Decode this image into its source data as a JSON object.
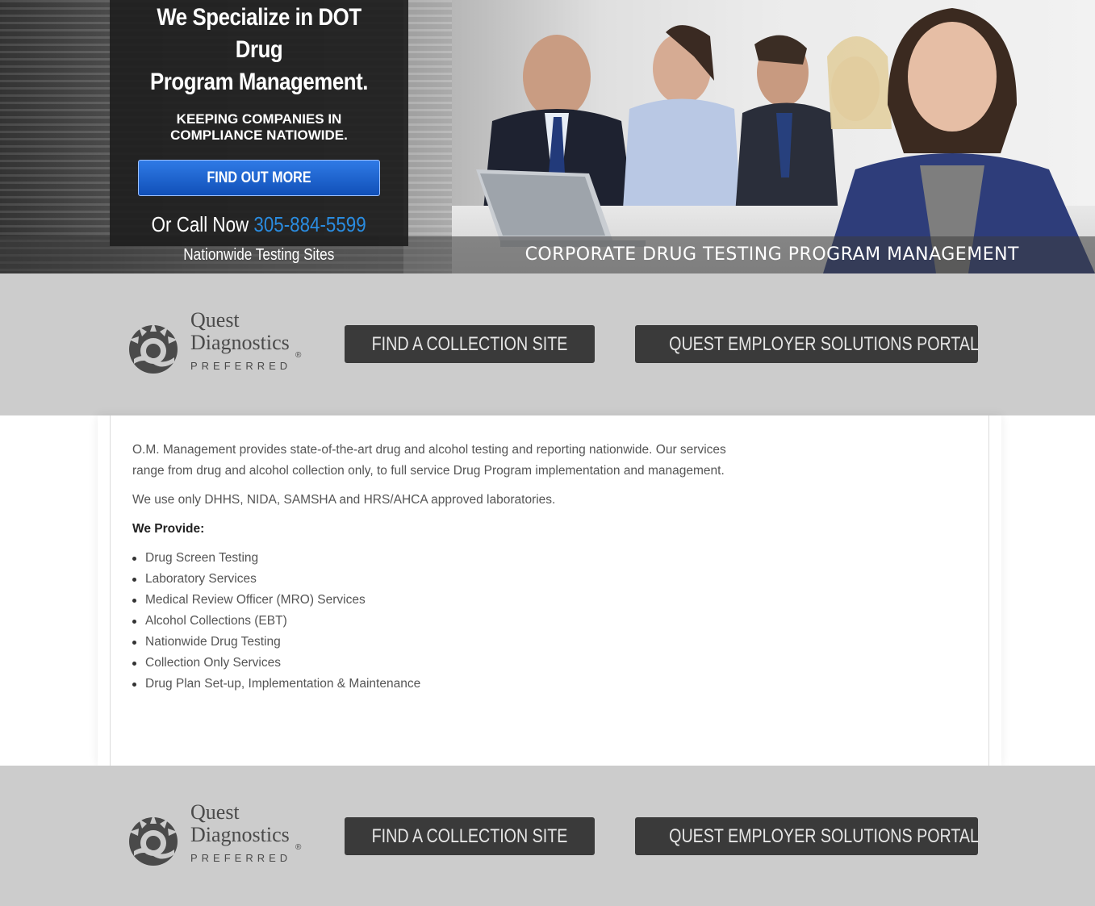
{
  "hero": {
    "title_line1": "We Specialize in DOT Drug",
    "title_line2": "Program Management.",
    "subtitle_line1": "KEEPING COMPANIES IN",
    "subtitle_line2": "COMPLIANCE NATIOWIDE.",
    "cta_label": "FIND OUT MORE",
    "call_label": "Or Call Now",
    "phone": "305-884-5599",
    "sites_label": "Nationwide Testing Sites",
    "caption": "CORPORATE DRUG TESTING PROGRAM MANAGEMENT"
  },
  "logo": {
    "line1": "Quest",
    "line2": "Diagnostics",
    "registered": "®",
    "line3": "PREFERRED"
  },
  "band": {
    "collection_label": "FIND A COLLECTION SITE",
    "portal_label": "QUEST EMPLOYER SOLUTIONS PORTAL"
  },
  "content": {
    "intro": "O.M. Management provides state-of-the-art drug and alcohol testing and reporting nationwide. Our services range from drug and alcohol collection only, to full service Drug Program implementation and management.",
    "labs": "We use only DHHS, NIDA, SAMSHA and HRS/AHCA approved laboratories.",
    "provide_heading": "We Provide:",
    "services": [
      "Drug Screen Testing",
      "Laboratory Services",
      "Medical Review Officer (MRO) Services",
      "Alcohol Collections (EBT)",
      "Nationwide Drug Testing",
      "Collection Only Services",
      "Drug Plan Set-up, Implementation & Maintenance"
    ]
  },
  "colors": {
    "accent_blue": "#1f66d6",
    "phone_blue": "#2a8ce0",
    "band_gray": "#cccccc",
    "button_dark": "#3a3a3a"
  }
}
